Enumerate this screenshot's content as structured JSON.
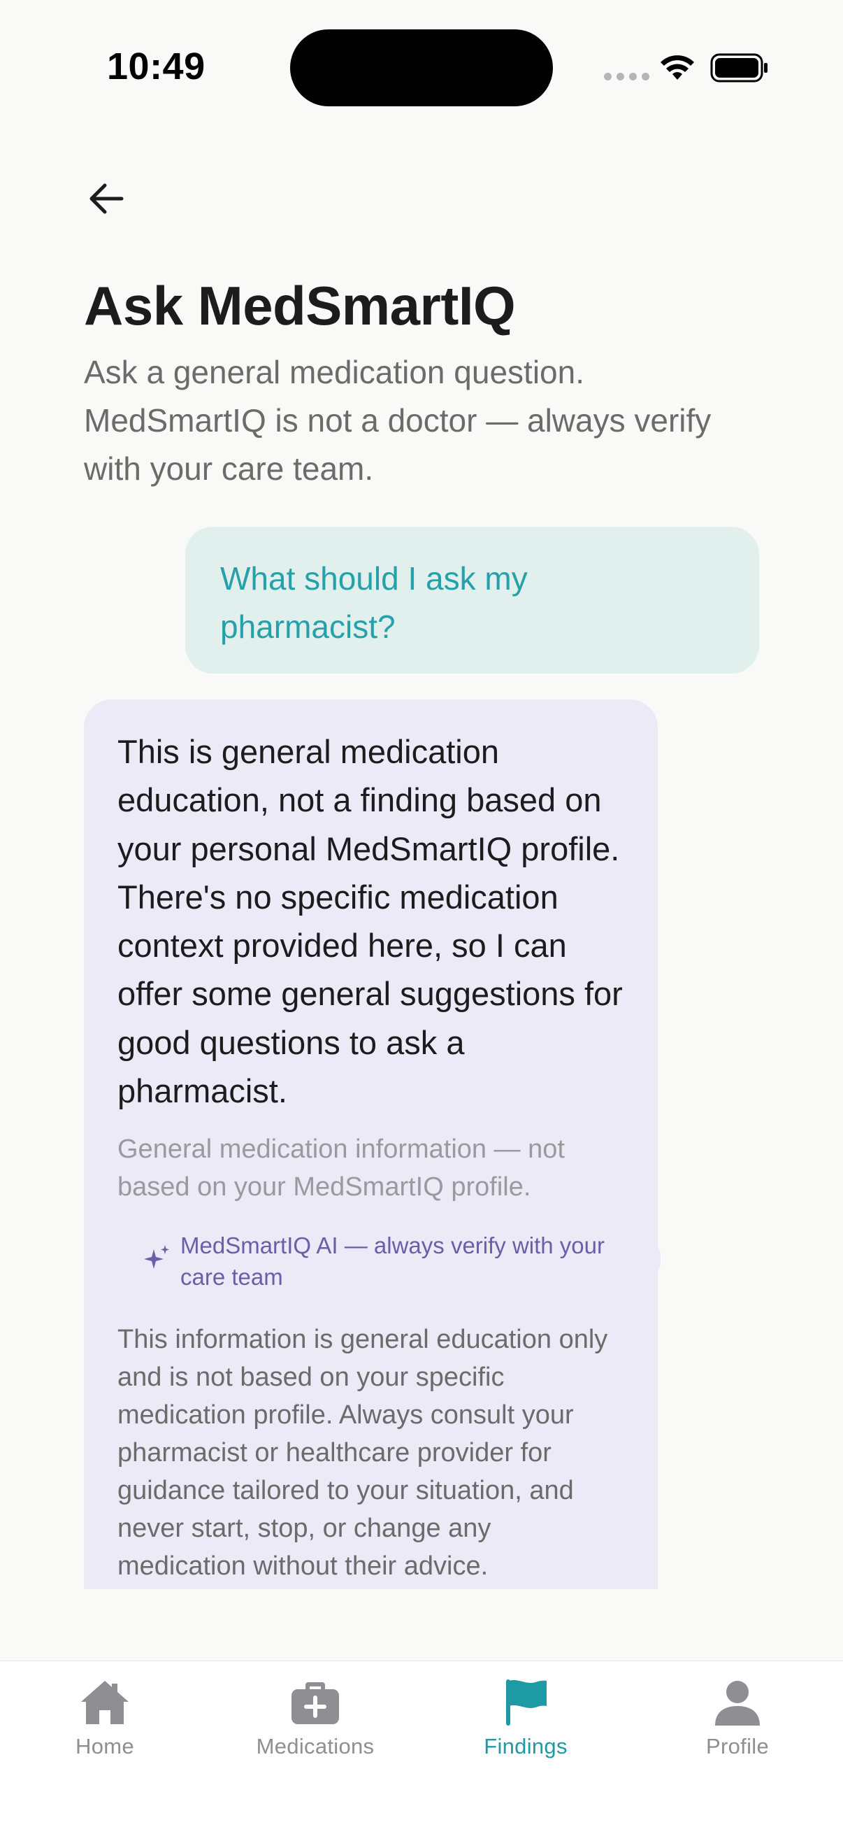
{
  "status_bar": {
    "time": "10:49"
  },
  "header": {
    "title": "Ask MedSmartIQ",
    "subtitle": "Ask a general medication question. MedSmartIQ is not a doctor — always verify with your care team."
  },
  "chat": {
    "user_message": "What should I ask my pharmacist?",
    "ai_message": "This is general medication education, not a finding based on your personal MedSmartIQ profile. There's no specific medication context provided here, so I can offer some general suggestions for good questions to ask a pharmacist.",
    "ai_note": "General medication information — not based on your MedSmartIQ profile.",
    "ai_badge": "MedSmartIQ AI — always verify with your care team",
    "ai_disclaimer": "This information is general education only and is not based on your specific medication profile. Always consult your pharmacist or healthcare provider for guidance tailored to your situation, and never start, stop, or change any medication without their advice."
  },
  "tab_bar": {
    "tabs": [
      {
        "label": "Home",
        "icon": "home-icon",
        "active": false
      },
      {
        "label": "Medications",
        "icon": "medkit-icon",
        "active": false
      },
      {
        "label": "Findings",
        "icon": "flag-icon",
        "active": true
      },
      {
        "label": "Profile",
        "icon": "person-icon",
        "active": false
      }
    ]
  },
  "colors": {
    "accent": "#1E9AA5",
    "user_bubble": "#E1EFED",
    "ai_bubble": "#ECEAF7",
    "ai_badge_text": "#6B5EA8",
    "inactive_tab": "#8E8E93"
  }
}
